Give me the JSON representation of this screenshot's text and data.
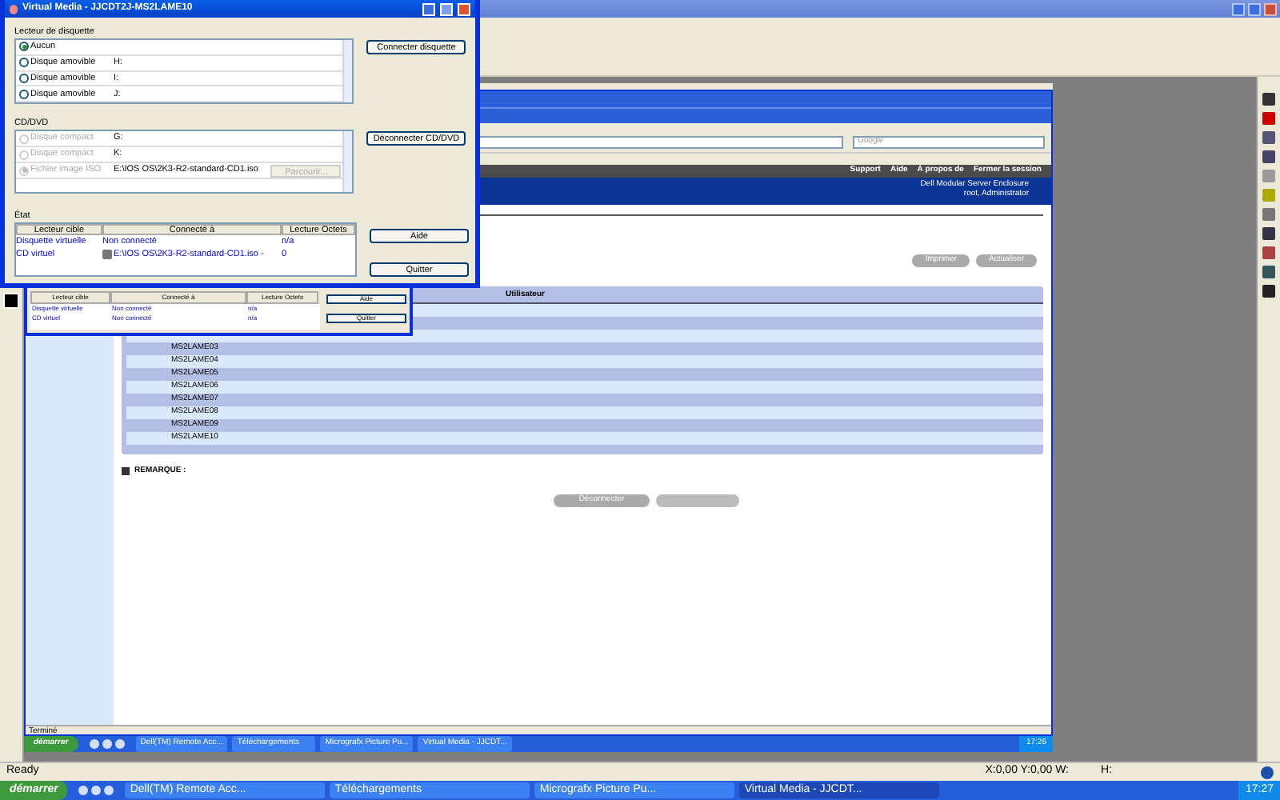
{
  "app": {
    "status": "Ready",
    "coords": "X:0,00 Y:0,00 W:",
    "height_label": "H:"
  },
  "taskbar": {
    "start": "démarrer",
    "time": "17:27",
    "tasks": [
      {
        "label": "Dell(TM) Remote Acc...",
        "selected": false
      },
      {
        "label": "Téléchargements",
        "selected": false
      },
      {
        "label": "Micrografx Picture Pu...",
        "selected": false
      },
      {
        "label": "Virtual Media - JJCDT...",
        "selected": true
      }
    ]
  },
  "remote": {
    "search_placeholder": "Google",
    "header_links": [
      "Support",
      "Aide",
      "À propos de",
      "Fermer la session"
    ],
    "header_info": [
      "Dell Modular Server Enclosure",
      "root, Administrator"
    ],
    "buttons": [
      "Imprimer",
      "Actualiser"
    ],
    "table": {
      "column": "Utilisateur",
      "rows": [
        "MS2LAME03",
        "MS2LAME04",
        "MS2LAME05",
        "MS2LAME06",
        "MS2LAME07",
        "MS2LAME08",
        "MS2LAME09",
        "MS2LAME10"
      ]
    },
    "note_label": "REMARQUE :",
    "disconnect": "Déconnecter",
    "status": "Terminé",
    "taskbar": {
      "start": "démarrer",
      "time": "17:26",
      "tasks": [
        "Dell(TM) Remote Acc...",
        "Téléchargements",
        "Micrografx Picture Pu...",
        "Virtual Media - JJCDT..."
      ]
    },
    "ghost": {
      "columns": [
        "Lecteur cible",
        "Connecté à",
        "Lecture Octets"
      ],
      "rows": [
        [
          "Disquette virtuelle",
          "Non connecté",
          "n/a"
        ],
        [
          "CD virtuel",
          "Non connecté",
          "n/a"
        ]
      ],
      "buttons": [
        "Aide",
        "Quitter"
      ]
    }
  },
  "dialog": {
    "title": "Virtual Media - JJCDT2J-MS2LAME10",
    "floppy": {
      "label": "Lecteur de disquette",
      "button": "Connecter disquette",
      "items": [
        {
          "label": "Aucun",
          "selected": true,
          "disabled": false
        },
        {
          "label": "Disque amovible",
          "drive": "H:",
          "selected": false,
          "disabled": false
        },
        {
          "label": "Disque amovible",
          "drive": "I:",
          "selected": false,
          "disabled": false
        },
        {
          "label": "Disque amovible",
          "drive": "J:",
          "selected": false,
          "disabled": false
        }
      ]
    },
    "cd": {
      "label": "CD/DVD",
      "button": "Déconnecter CD/DVD",
      "browse": "Parcourir...",
      "items": [
        {
          "label": "Disque compact",
          "drive": "G:",
          "selected": false,
          "disabled": true
        },
        {
          "label": "Disque compact",
          "drive": "K:",
          "selected": false,
          "disabled": true
        },
        {
          "label": "Fichier image ISO",
          "drive": "E:\\IOS OS\\2K3-R2-standard-CD1.iso",
          "selected": true,
          "disabled": true
        }
      ]
    },
    "status": {
      "label": "État",
      "columns": [
        "Lecteur cible",
        "Connecté à",
        "Lecture Octets"
      ],
      "rows": [
        {
          "target": "Disquette virtuelle",
          "connected": "Non connecté",
          "bytes": "n/a",
          "kind": "floppy"
        },
        {
          "target": "CD virtuel",
          "connected": "E:\\IOS OS\\2K3-R2-standard-CD1.iso -",
          "bytes": "0",
          "kind": "cd"
        }
      ]
    },
    "buttons": [
      "Aide",
      "Quitter"
    ]
  }
}
